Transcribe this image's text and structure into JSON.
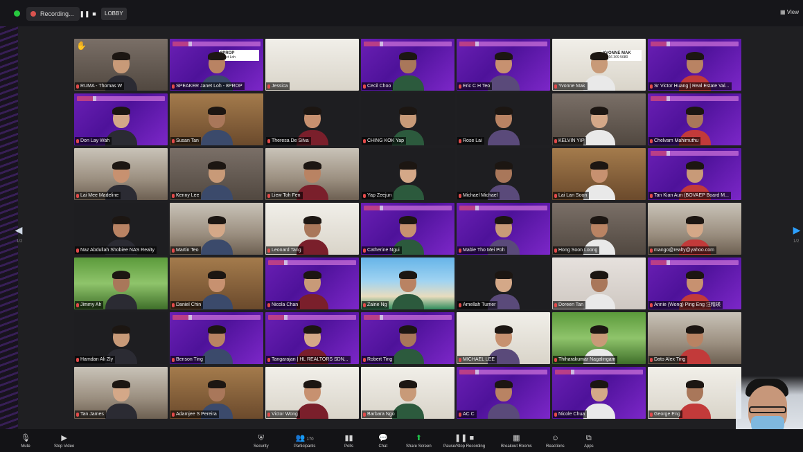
{
  "topbar": {
    "recording_label": "Recording...",
    "lobby_label": "LOBBY",
    "view_label": "View"
  },
  "participants": [
    {
      "name": "RUMA - Thomas W",
      "bg": "bg-office",
      "hand": true
    },
    {
      "name": "SPEAKER Janet Loh - 8PROP",
      "bg": "bg-purple",
      "card": {
        "title": "8PROP",
        "sub": "Janet Loh"
      }
    },
    {
      "name": "Jessica",
      "bg": "bg-white",
      "noperson": true
    },
    {
      "name": "Cecil Choo",
      "bg": "bg-purple"
    },
    {
      "name": "Eric C H Teo",
      "bg": "bg-purple"
    },
    {
      "name": "Yvonne Mak",
      "bg": "bg-white",
      "card": {
        "title": "YVONNE MAK",
        "sub": "+6016 309 5680"
      }
    },
    {
      "name": "Sr Victor Huang | Real Estate Val...",
      "bg": "bg-purple"
    },
    {
      "name": "Don Lay Wah",
      "bg": "bg-purple"
    },
    {
      "name": "Susan Tan",
      "bg": "bg-warm"
    },
    {
      "name": "Theresa De Silva",
      "bg": "bg-dark"
    },
    {
      "name": "CHING KOK Yap",
      "bg": "bg-dark"
    },
    {
      "name": "Rose Lai",
      "bg": "bg-dark"
    },
    {
      "name": "KELVIN YIP",
      "bg": "bg-office"
    },
    {
      "name": "Chelvam Mahimuthu",
      "bg": "bg-purple"
    },
    {
      "name": "Lai Mee Madeline",
      "bg": "bg-room"
    },
    {
      "name": "Kenny Lee",
      "bg": "bg-office"
    },
    {
      "name": "Liew Toh Fen",
      "bg": "bg-room"
    },
    {
      "name": "Yap Zeejun",
      "bg": "bg-dark"
    },
    {
      "name": "Michael Michael",
      "bg": "bg-dark"
    },
    {
      "name": "Lai Lan Soon",
      "bg": "bg-warm"
    },
    {
      "name": "Tan Kian Aun (BOVAEP Board M...",
      "bg": "bg-purple"
    },
    {
      "name": "Naz Abdullah Shobiee NAS Realty",
      "bg": "bg-dark"
    },
    {
      "name": "Martin Teo",
      "bg": "bg-room"
    },
    {
      "name": "Leonard Tang",
      "bg": "bg-white"
    },
    {
      "name": "Catherine Ngui",
      "bg": "bg-purple"
    },
    {
      "name": "Mable Tho Mei Poh",
      "bg": "bg-purple"
    },
    {
      "name": "Hong Soon Loong",
      "bg": "bg-office"
    },
    {
      "name": "mango@realty@yahoo.com",
      "bg": "bg-room"
    },
    {
      "name": "Jimmy Ah",
      "bg": "bg-green"
    },
    {
      "name": "Daniel Chin",
      "bg": "bg-warm"
    },
    {
      "name": "Nicola Chan",
      "bg": "bg-purple"
    },
    {
      "name": "Zaine Ng",
      "bg": "bg-beach"
    },
    {
      "name": "Amellah Turner",
      "bg": "bg-dark"
    },
    {
      "name": "Doreen Tan",
      "bg": "bg-red"
    },
    {
      "name": "Annie (Wong) Ping Eng 汪精瑛",
      "bg": "bg-purple"
    },
    {
      "name": "Hamdan Ali Zly",
      "bg": "bg-dark"
    },
    {
      "name": "Benson Ting",
      "bg": "bg-purple"
    },
    {
      "name": "Tangarajan | HL REALTORS SDN...",
      "bg": "bg-purple"
    },
    {
      "name": "Robert Ting",
      "bg": "bg-purple"
    },
    {
      "name": "MICHAEL LEE",
      "bg": "bg-white"
    },
    {
      "name": "Thiharakumar Nagalingam",
      "bg": "bg-green"
    },
    {
      "name": "Dato Alex Ting",
      "bg": "bg-room"
    },
    {
      "name": "Tan James",
      "bg": "bg-room"
    },
    {
      "name": "Adamjee S Pereira",
      "bg": "bg-warm"
    },
    {
      "name": "Victor Wong",
      "bg": "bg-white"
    },
    {
      "name": "Barbara Ngo",
      "bg": "bg-white"
    },
    {
      "name": "AC C",
      "bg": "bg-purple"
    },
    {
      "name": "Nicole Chua",
      "bg": "bg-purple"
    },
    {
      "name": "George Eng",
      "bg": "bg-white"
    }
  ],
  "nav": {
    "left_page": "1/2",
    "right_page": "1/2"
  },
  "toolbar": {
    "mute": {
      "icon": "microphone-icon",
      "label": "Mute"
    },
    "stop_video": {
      "icon": "video-camera-icon",
      "label": "Stop Video"
    },
    "security": {
      "icon": "shield-icon",
      "label": "Security"
    },
    "participants": {
      "icon": "participants-icon",
      "label": "Participants",
      "count": "170"
    },
    "polls": {
      "icon": "polls-icon",
      "label": "Polls"
    },
    "chat": {
      "icon": "chat-icon",
      "label": "Chat"
    },
    "share_screen": {
      "icon": "share-screen-icon",
      "label": "Share Screen"
    },
    "pause_recording": {
      "icon": "pause-stop-icon",
      "label": "Pause/Stop Recording"
    },
    "breakout": {
      "icon": "breakout-rooms-icon",
      "label": "Breakout Rooms"
    },
    "reactions": {
      "icon": "reactions-icon",
      "label": "Reactions"
    },
    "apps": {
      "icon": "apps-icon",
      "label": "Apps"
    }
  },
  "colors": {
    "accent_purple": "#6a1fb4",
    "share_green": "#1fc24a",
    "recording_red": "#d9534f"
  }
}
